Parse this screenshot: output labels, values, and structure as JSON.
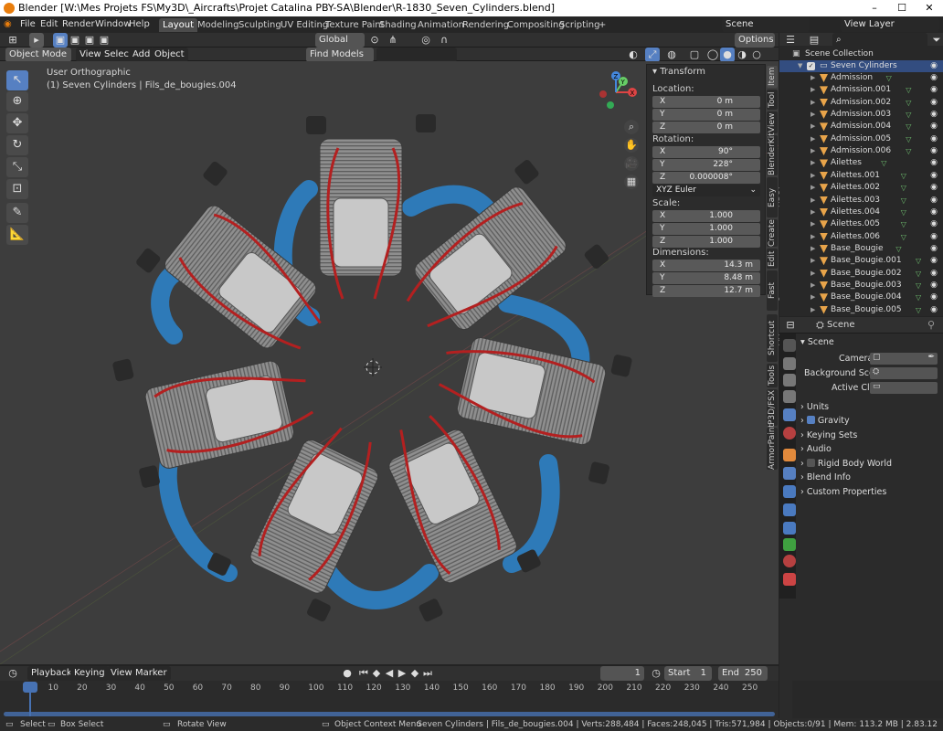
{
  "window": {
    "title": "Blender [W:\\Mes Projets FS\\My3D\\_Aircrafts\\Projet Catalina PBY-SA\\Blender\\R-1830_Seven_Cylinders.blend]"
  },
  "menu": [
    "File",
    "Edit",
    "Render",
    "Window",
    "Help"
  ],
  "workspaces": [
    "Layout",
    "Modeling",
    "Sculpting",
    "UV Editing",
    "Texture Paint",
    "Shading",
    "Animation",
    "Rendering",
    "Compositing",
    "Scripting",
    "+"
  ],
  "scene_field": "Scene",
  "view_layer_field": "View Layer",
  "header": {
    "orientation": "Global",
    "options": "Options",
    "mode": "Object Mode",
    "view": "View",
    "select": "Select",
    "add": "Add",
    "object": "Object",
    "find_models": "Find Models"
  },
  "viewport": {
    "view_name": "User Orthographic",
    "object_info": "(1) Seven Cylinders | Fils_de_bougies.004"
  },
  "gizmo": {
    "x": "X",
    "y": "Y",
    "z": "Z"
  },
  "npanel": {
    "title": "Transform",
    "location_label": "Location:",
    "location": [
      {
        "k": "X",
        "v": "0 m"
      },
      {
        "k": "Y",
        "v": "0 m"
      },
      {
        "k": "Z",
        "v": "0 m"
      }
    ],
    "rotation_label": "Rotation:",
    "rotation": [
      {
        "k": "X",
        "v": "90°"
      },
      {
        "k": "Y",
        "v": "228°"
      },
      {
        "k": "Z",
        "v": "0.000008°"
      }
    ],
    "euler": "XYZ Euler",
    "scale_label": "Scale:",
    "scale": [
      {
        "k": "X",
        "v": "1.000"
      },
      {
        "k": "Y",
        "v": "1.000"
      },
      {
        "k": "Z",
        "v": "1.000"
      }
    ],
    "dimensions_label": "Dimensions:",
    "dimensions": [
      {
        "k": "X",
        "v": "14.3 m"
      },
      {
        "k": "Y",
        "v": "8.48 m"
      },
      {
        "k": "Z",
        "v": "12.7 m"
      }
    ]
  },
  "side_tabs": [
    "Item",
    "Tool",
    "View",
    "BlenderKit",
    "Easy HDRI",
    "Create",
    "Edit",
    "Fast Carve",
    "Shortcut VUr",
    "Tools",
    "P3D/FSX",
    "ArmorPaint"
  ],
  "outliner": {
    "collection": "Scene Collection",
    "root": "Seven Cylinders",
    "items": [
      "Admission",
      "Admission.001",
      "Admission.002",
      "Admission.003",
      "Admission.004",
      "Admission.005",
      "Admission.006",
      "Ailettes",
      "Ailettes.001",
      "Ailettes.002",
      "Ailettes.003",
      "Ailettes.004",
      "Ailettes.005",
      "Ailettes.006",
      "Base_Bougie",
      "Base_Bougie.001",
      "Base_Bougie.002",
      "Base_Bougie.003",
      "Base_Bougie.004",
      "Base_Bougie.005"
    ]
  },
  "properties": {
    "context": "Scene",
    "panel": "Scene",
    "camera_label": "Camera",
    "bg_scene_label": "Background Scene",
    "active_clip_label": "Active Clip",
    "sections": [
      "Units",
      "Gravity",
      "Keying Sets",
      "Audio",
      "Rigid Body World",
      "Blend Info",
      "Custom Properties"
    ]
  },
  "timeline": {
    "playback": "Playback",
    "keying": "Keying",
    "view": "View",
    "marker": "Marker",
    "current_frame": "1",
    "start_label": "Start",
    "start": "1",
    "end_label": "End",
    "end": "250",
    "ticks": [
      "1",
      "10",
      "20",
      "30",
      "40",
      "50",
      "60",
      "70",
      "80",
      "90",
      "100",
      "110",
      "120",
      "130",
      "140",
      "150",
      "160",
      "170",
      "180",
      "190",
      "200",
      "210",
      "220",
      "230",
      "240",
      "250"
    ]
  },
  "status": {
    "select": "Select",
    "box_select": "Box Select",
    "rotate_view": "Rotate View",
    "context_menu": "Object Context Menu",
    "stats": "Seven Cylinders | Fils_de_bougies.004 | Verts:288,484 | Faces:248,045 | Tris:571,984 | Objects:0/91 | Mem: 113.2 MB | 2.83.12"
  },
  "colors": {
    "accent": "#5680c2",
    "pipe": "#2e7ab8",
    "wire": "#b32020",
    "metal": "#9a9a9a"
  }
}
